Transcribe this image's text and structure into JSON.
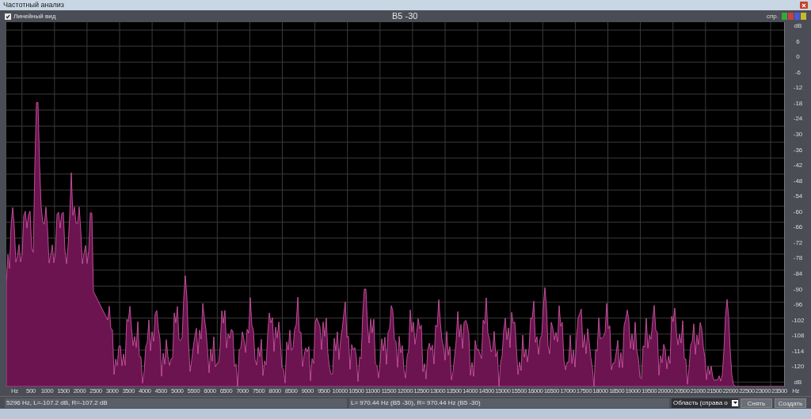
{
  "window": {
    "title": "Частотный анализ"
  },
  "toolbar": {
    "linear_view": {
      "label": "Линейный вид",
      "checked": true
    },
    "trace_title": "B5 -30",
    "channel_label": "спр.",
    "channel_buttons": [
      {
        "color": "#3aa63a"
      },
      {
        "color": "#c84040"
      },
      {
        "color": "#4a5ad0"
      },
      {
        "color": "#c8b830"
      }
    ]
  },
  "y_axis": {
    "labels": [
      "dB",
      "6",
      "0",
      "-6",
      "-12",
      "-18",
      "-24",
      "-30",
      "-36",
      "-42",
      "-48",
      "-54",
      "-60",
      "-66",
      "-72",
      "-78",
      "-84",
      "-90",
      "-96",
      "-102",
      "-108",
      "-114",
      "-120",
      "dB"
    ]
  },
  "x_axis": {
    "labels": [
      "Hz",
      "500",
      "1000",
      "1500",
      "2000",
      "2500",
      "3000",
      "3500",
      "4000",
      "4500",
      "5000",
      "5500",
      "6000",
      "6500",
      "7000",
      "7500",
      "8000",
      "8500",
      "9000",
      "9500",
      "10000",
      "10500",
      "11000",
      "11500",
      "12000",
      "12500",
      "13000",
      "13500",
      "14000",
      "14500",
      "15000",
      "15500",
      "16000",
      "16500",
      "17000",
      "17500",
      "18000",
      "18500",
      "19000",
      "19500",
      "20000",
      "20500",
      "21000",
      "21500",
      "22000",
      "22500",
      "23000",
      "23500",
      "Hz"
    ]
  },
  "status_bar": {
    "cursor_reading": "5296 Hz, L=-107.2 dB, R=-107.2 dB",
    "marker_reading": "L= 970.44 Hz (B5 -30), R= 970.44 Hz (B5 -30)",
    "range_select": {
      "value": "Область (справа о"
    },
    "buttons": [
      "Снять",
      "Создать"
    ]
  }
}
